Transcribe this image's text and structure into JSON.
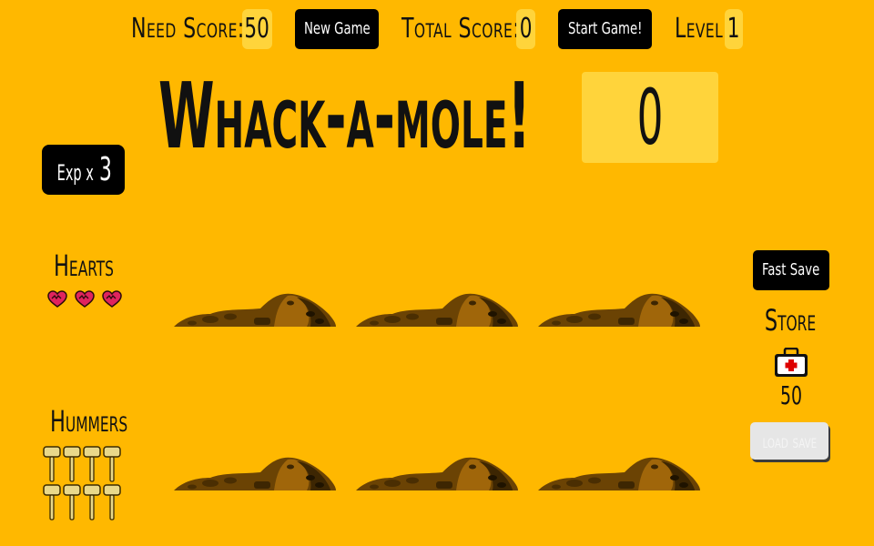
{
  "header": {
    "need_score_label": "Need Score:",
    "need_score_value": "50",
    "new_game_label": "New Game",
    "total_score_label": "Total Score:",
    "total_score_value": "0",
    "start_game_label": "Start Game!",
    "level_label": "Level",
    "level_value": "1"
  },
  "title": "Whack-a-mole!",
  "score": "0",
  "exp": {
    "label": "Exp x",
    "value": "3"
  },
  "hearts": {
    "label": "Hearts",
    "count": 3
  },
  "hummers": {
    "label": "Hummers",
    "count": 8
  },
  "right_panel": {
    "fast_save_label": "Fast Save",
    "store_label": "Store",
    "medkit_price": "50",
    "load_save_label": "load save"
  },
  "board": {
    "rows": 2,
    "cols": 3
  },
  "colors": {
    "background": "#ffb800",
    "chip": "#ffd43b",
    "button": "#000000",
    "dirt": "#6b4304"
  },
  "icons": {
    "heart": "heart-icon",
    "hammer": "hammer-icon",
    "medkit": "medkit-icon",
    "dirt": "dirt-mound-icon"
  }
}
